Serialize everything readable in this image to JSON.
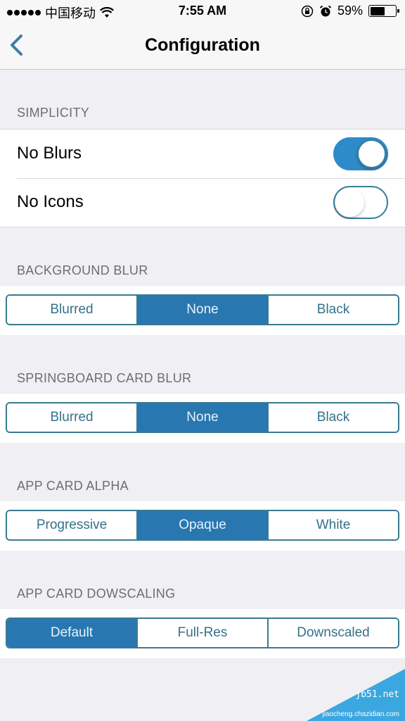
{
  "status_bar": {
    "carrier": "中国移动",
    "time": "7:55 AM",
    "battery_percent_label": "59%",
    "battery_level": 0.59,
    "icons": [
      "signal-dots-icon",
      "wifi-icon",
      "rotation-lock-icon",
      "alarm-icon",
      "battery-icon"
    ]
  },
  "nav": {
    "title": "Configuration",
    "back_icon": "chevron-left-icon"
  },
  "sections": {
    "simplicity": {
      "header": "SIMPLICITY",
      "rows": [
        {
          "label": "No Blurs",
          "on": true
        },
        {
          "label": "No Icons",
          "on": false
        }
      ]
    },
    "background_blur": {
      "header": "BACKGROUND BLUR",
      "options": [
        "Blurred",
        "None",
        "Black"
      ],
      "selected": "None"
    },
    "springboard_card_blur": {
      "header": "SPRINGBOARD CARD BLUR",
      "options": [
        "Blurred",
        "None",
        "Black"
      ],
      "selected": "None"
    },
    "app_card_alpha": {
      "header": "APP CARD ALPHA",
      "options": [
        "Progressive",
        "Opaque",
        "White"
      ],
      "selected": "Opaque"
    },
    "app_card_downscaling": {
      "header": "APP CARD DOWSCALING",
      "options": [
        "Default",
        "Full-Res",
        "Downscaled"
      ],
      "selected": "Default"
    }
  },
  "watermark": {
    "line1": "jb51.net",
    "line2": "jiaocheng.chazidian.com"
  },
  "colors": {
    "accent": "#2877b0",
    "toggle_on": "#2e8bc9",
    "background": "#efeff4"
  }
}
